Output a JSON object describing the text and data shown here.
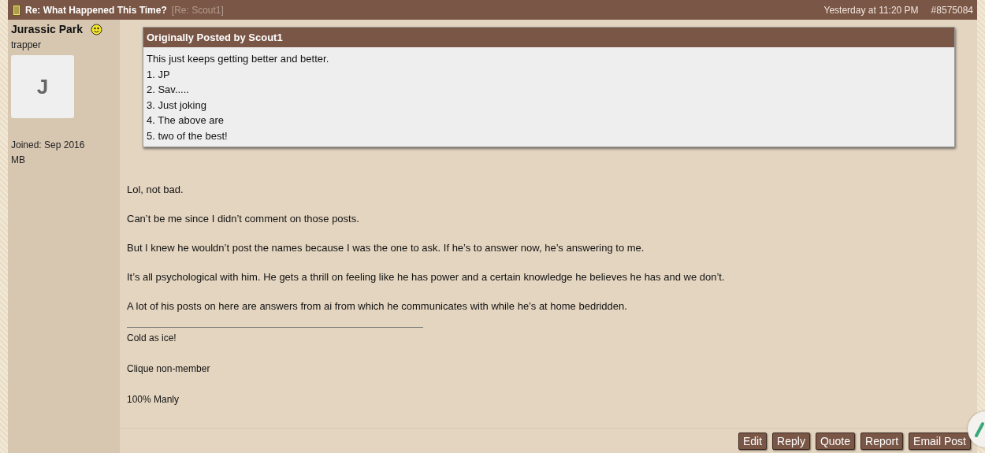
{
  "post_header": {
    "title": "Re: What Happened This Time?",
    "subtitle": "[Re: Scout1]",
    "time": "Yesterday at 11:20 PM",
    "post_number": "#8575084"
  },
  "author": {
    "name": "Jurassic Park",
    "rank": "trapper",
    "avatar_letter": "J",
    "joined": "Joined: Sep 2016",
    "location": "MB"
  },
  "quote": {
    "heading": "Originally Posted by Scout1",
    "lines": [
      "This just keeps getting better and better.",
      "1. JP",
      "2. Sav.....",
      "3. Just joking",
      "4. The above are",
      "5. two of the best!"
    ]
  },
  "paragraphs": [
    "Lol, not bad.",
    "Can’t be me since I didn’t comment on those posts.",
    "But I knew he wouldn’t post the names because I was the one to ask. If he’s to answer now, he’s answering to me.",
    "It’s all psychological with him. He gets a thrill on feeling like he has power and a certain knowledge he believes he has and we don’t.",
    "A lot of his posts on here are answers from ai from which he communicates with while he’s at home bedridden."
  ],
  "signature": [
    "Cold as ice!",
    "Clique non-member",
    "100% Manly"
  ],
  "actions": [
    "Edit",
    "Reply",
    "Quote",
    "Report",
    "Email Post"
  ]
}
